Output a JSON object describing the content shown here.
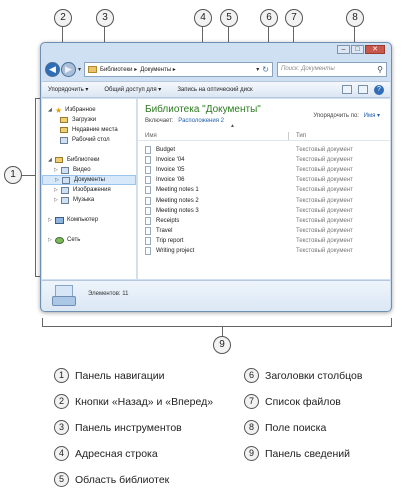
{
  "callouts": [
    "1",
    "2",
    "3",
    "4",
    "5",
    "6",
    "7",
    "8",
    "9"
  ],
  "window": {
    "address": {
      "crumbs": [
        "Библиотеки ▸",
        "Документы ▸"
      ],
      "dropdown": "▾",
      "refresh": "↻"
    },
    "search": {
      "placeholder": "Поиск: Документы",
      "icon": "search-icon"
    },
    "toolbar": {
      "items": [
        "Упорядочить ▾",
        "Общий доступ для ▾",
        "Запись на оптический диск"
      ],
      "help": "?"
    },
    "nav_pane": {
      "favorites": "Избранное",
      "downloads": "Загрузки",
      "recent": "Недавние места",
      "desktop": "Рабочий стол",
      "libraries": "Библиотеки",
      "video": "Видео",
      "documents": "Документы",
      "images": "Изображения",
      "music": "Музыка",
      "computer": "Компьютер",
      "network": "Сеть"
    },
    "library": {
      "title": "Библиотека \"Документы\"",
      "includes_label": "Включает:",
      "includes_value": "Расположения 2",
      "arrange_label": "Упорядочить по:",
      "arrange_value": "Имя ▾"
    },
    "columns": {
      "name": "Имя",
      "type": "Тип"
    },
    "files": [
      {
        "name": "Budget",
        "type": "Текстовый документ"
      },
      {
        "name": "Invoice '04",
        "type": "Текстовый документ"
      },
      {
        "name": "Invoice '05",
        "type": "Текстовый документ"
      },
      {
        "name": "Invoice '06",
        "type": "Текстовый документ"
      },
      {
        "name": "Meeting notes 1",
        "type": "Текстовый документ"
      },
      {
        "name": "Meeting notes 2",
        "type": "Текстовый документ"
      },
      {
        "name": "Meeting notes 3",
        "type": "Текстовый документ"
      },
      {
        "name": "Receipts",
        "type": "Текстовый документ"
      },
      {
        "name": "Travel",
        "type": "Текстовый документ"
      },
      {
        "name": "Trip report",
        "type": "Текстовый документ"
      },
      {
        "name": "Writing project",
        "type": "Текстовый документ"
      }
    ],
    "details": {
      "count": "Элементов: 11"
    }
  },
  "legend": [
    {
      "num": "1",
      "label": "Панель навигации"
    },
    {
      "num": "2",
      "label": "Кнопки «Назад» и «Вперед»"
    },
    {
      "num": "3",
      "label": "Панель инструментов"
    },
    {
      "num": "4",
      "label": "Адресная строка"
    },
    {
      "num": "5",
      "label": "Область библиотек"
    },
    {
      "num": "6",
      "label": "Заголовки столбцов"
    },
    {
      "num": "7",
      "label": "Список файлов"
    },
    {
      "num": "8",
      "label": "Поле поиска"
    },
    {
      "num": "9",
      "label": "Панель сведений"
    }
  ]
}
